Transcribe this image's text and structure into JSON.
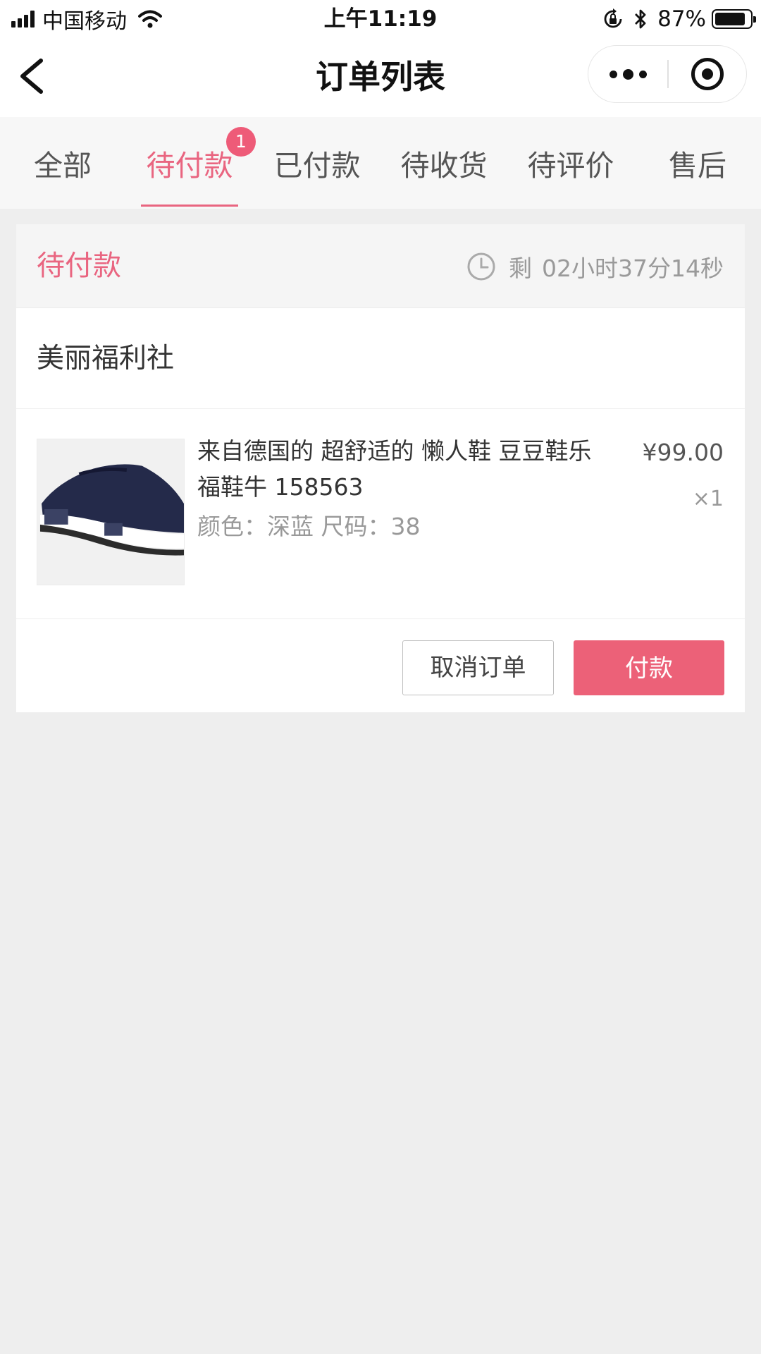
{
  "status_bar": {
    "carrier": "中国移动",
    "time": "上午11:19",
    "battery_percent": "87%",
    "battery_level": 0.87
  },
  "nav": {
    "title": "订单列表"
  },
  "tabs": [
    {
      "label": "全部"
    },
    {
      "label": "待付款",
      "badge": "1"
    },
    {
      "label": "已付款"
    },
    {
      "label": "待收货"
    },
    {
      "label": "待评价"
    },
    {
      "label": "售后"
    }
  ],
  "active_tab": 1,
  "colors": {
    "accent": "#e96580",
    "pay_button": "#ec6178",
    "badge": "#ee5b78"
  },
  "order": {
    "status": "待付款",
    "countdown_prefix": "剩",
    "countdown": "02小时37分14秒",
    "shop_name": "美丽福利社",
    "product": {
      "image_icon": "navy-slip-on-sneaker",
      "title": "来自德国的 超舒适的 懒人鞋 豆豆鞋乐福鞋牛 158563",
      "spec": "颜色：深蓝 尺码：38",
      "price": "¥99.00",
      "quantity": "×1"
    },
    "actions": {
      "cancel": "取消订单",
      "pay": "付款"
    }
  }
}
